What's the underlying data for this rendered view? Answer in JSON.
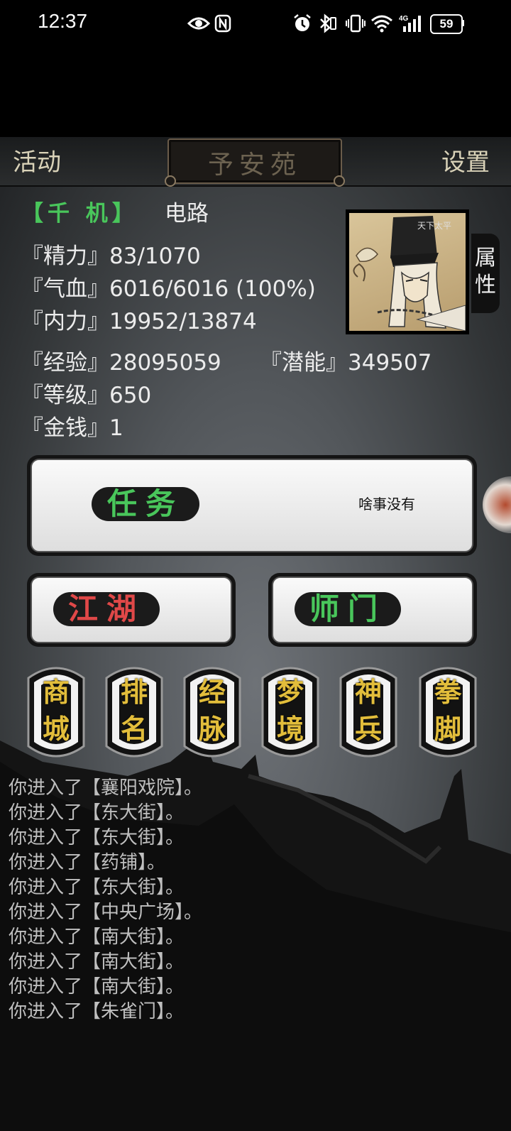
{
  "status_bar": {
    "time": "12:37",
    "battery": "59",
    "icons": [
      "eye-icon",
      "nfc-icon",
      "alarm-icon",
      "bluetooth-icon",
      "vibrate-icon",
      "wifi-icon",
      "signal-icon"
    ]
  },
  "top_bar": {
    "left_button": "活动",
    "location": "予安苑",
    "right_button": "设置"
  },
  "character": {
    "sect": "【千 机】",
    "name": "电路",
    "attr_tab": "属性",
    "stats": [
      {
        "label": "『精力』",
        "value": "83/1070"
      },
      {
        "label": "『气血』",
        "value": "6016/6016 (100%)"
      },
      {
        "label": "『内力』",
        "value": "19952/13874"
      },
      {
        "label": "『经验』",
        "value": "28095059"
      },
      {
        "label": "『潜能』",
        "value": "349507"
      },
      {
        "label": "『等级』",
        "value": "650"
      },
      {
        "label": "『金钱』",
        "value": "1"
      }
    ]
  },
  "task_panel": {
    "label": "任务",
    "description": "啥事没有"
  },
  "jianghu_panel": {
    "label": "江湖"
  },
  "shimen_panel": {
    "label": "师门"
  },
  "menu_buttons": [
    {
      "top": "商",
      "bottom": "城"
    },
    {
      "top": "排",
      "bottom": "名"
    },
    {
      "top": "经",
      "bottom": "脉"
    },
    {
      "top": "梦",
      "bottom": "境"
    },
    {
      "top": "神",
      "bottom": "兵"
    },
    {
      "top": "拳",
      "bottom": "脚"
    }
  ],
  "log": [
    "你进入了【襄阳戏院】。",
    "你进入了【东大街】。",
    "你进入了【东大街】。",
    "你进入了【药铺】。",
    "你进入了【东大街】。",
    "你进入了【中央广场】。",
    "你进入了【南大街】。",
    "你进入了【南大街】。",
    "你进入了【南大街】。",
    "你进入了【朱雀门】。"
  ],
  "colors": {
    "green": "#49c65b",
    "red": "#e04848",
    "gold": "#e2bd3b"
  }
}
